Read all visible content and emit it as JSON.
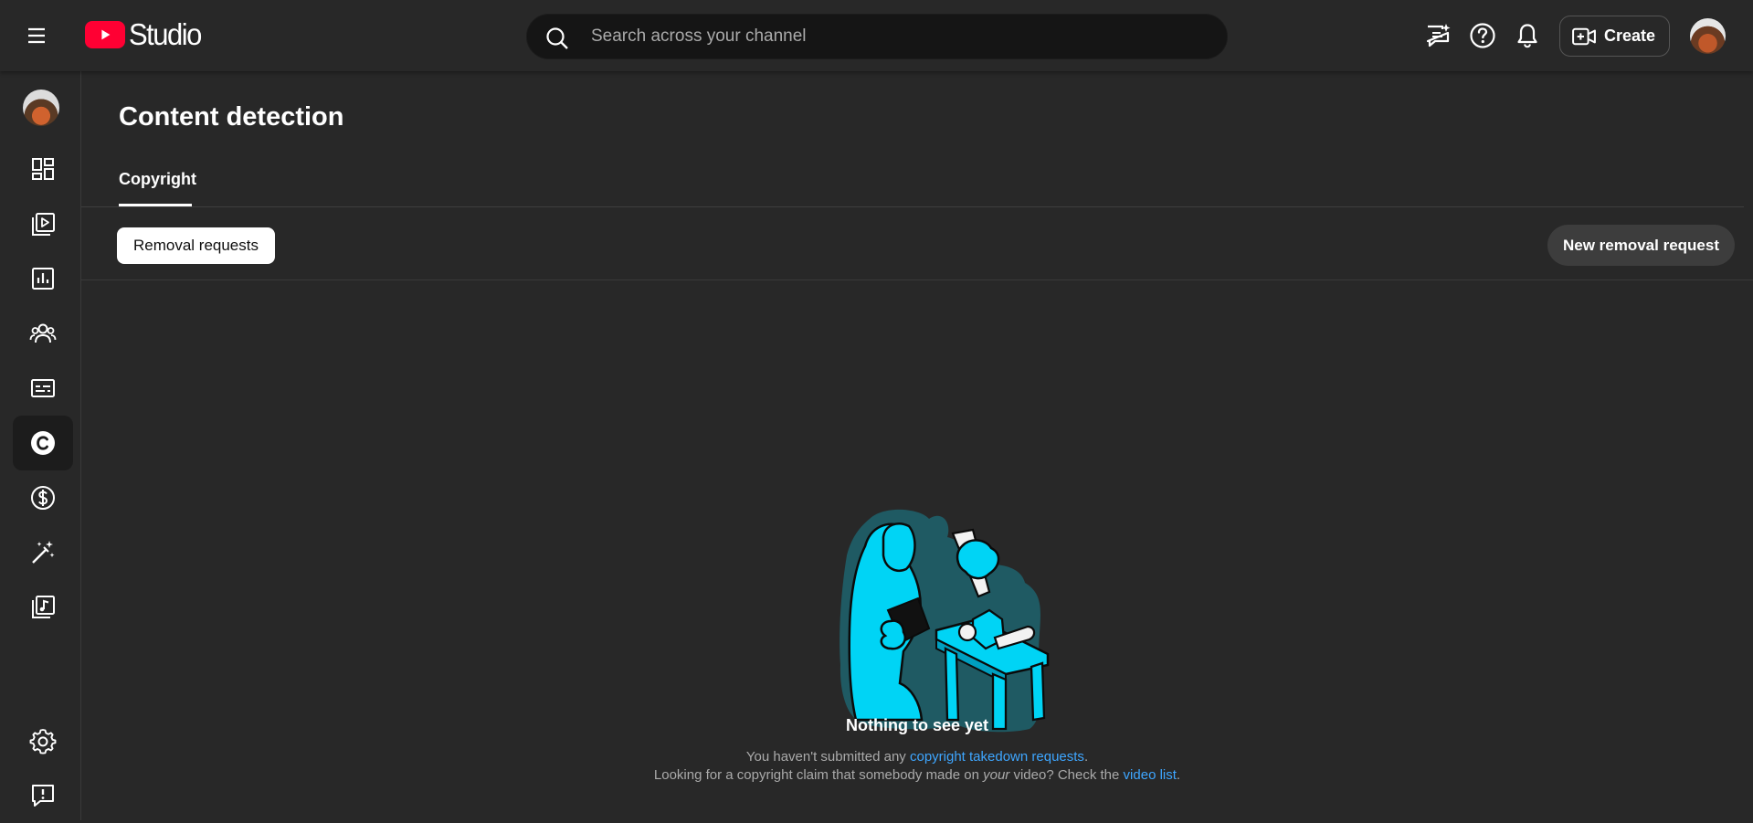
{
  "header": {
    "logo_text": "Studio",
    "search_placeholder": "Search across your channel",
    "create_label": "Create",
    "icons": [
      "menu-icon",
      "youtube-logo-icon",
      "search-icon",
      "feedback-sparkle-icon",
      "help-icon",
      "notifications-bell-icon",
      "create-video-icon"
    ]
  },
  "sidebar": {
    "items": [
      {
        "name": "dashboard",
        "icon": "dashboard-icon"
      },
      {
        "name": "content",
        "icon": "content-icon"
      },
      {
        "name": "analytics",
        "icon": "analytics-icon"
      },
      {
        "name": "community",
        "icon": "community-icon"
      },
      {
        "name": "subtitles",
        "icon": "subtitles-icon"
      },
      {
        "name": "copyright",
        "icon": "copyright-icon",
        "active": true
      },
      {
        "name": "earn",
        "icon": "dollar-icon"
      },
      {
        "name": "customization",
        "icon": "magic-wand-icon"
      },
      {
        "name": "audio-library",
        "icon": "audio-library-icon"
      },
      {
        "name": "settings",
        "icon": "gear-icon"
      },
      {
        "name": "send-feedback",
        "icon": "feedback-icon"
      }
    ]
  },
  "page": {
    "title": "Content detection",
    "tabs": [
      {
        "label": "Copyright",
        "active": true
      }
    ],
    "filter_chip": "Removal requests",
    "new_request_button": "New removal request"
  },
  "empty_state": {
    "title": "Nothing to see yet",
    "line1_prefix": "You haven't submitted any ",
    "line1_link": "copyright takedown requests",
    "line1_suffix": ".",
    "line2_prefix": "Looking for a copyright claim that somebody made on ",
    "line2_em": "your",
    "line2_middle": " video? Check the ",
    "line2_link": "video list",
    "line2_suffix": "."
  },
  "colors": {
    "background": "#282828",
    "accent_link": "#3ea6ff",
    "brand_red": "#ff0033",
    "illustration_cyan": "#00d4f5",
    "illustration_teal": "#1f5a63"
  }
}
